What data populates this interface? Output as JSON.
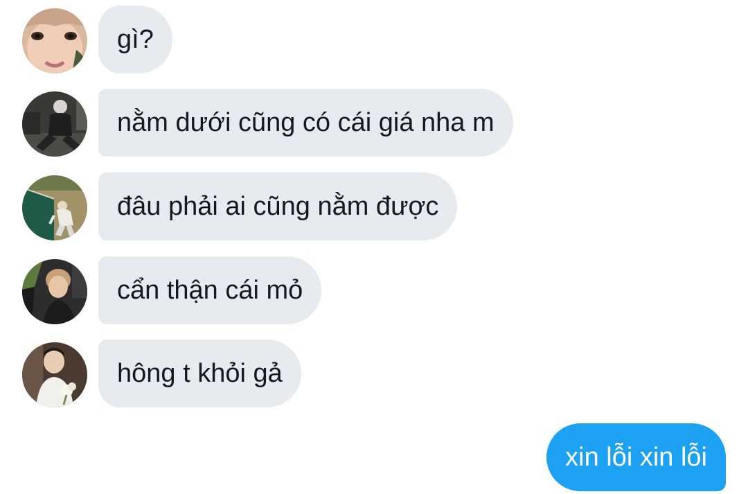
{
  "conversation": {
    "received": [
      {
        "text": "gì?",
        "avatar": "avatar-close-up-face"
      },
      {
        "text": "nằm dưới cũng có cái giá nha m",
        "avatar": "avatar-sitting-night"
      },
      {
        "text": "đâu phải ai cũng nằm được",
        "avatar": "avatar-outdoor-grass"
      },
      {
        "text": "cẩn thận cái mỏ",
        "avatar": "avatar-car-selfie"
      },
      {
        "text": "hông t khỏi gả",
        "avatar": "avatar-white-shirt-flowers"
      }
    ],
    "sent": [
      {
        "text": "xin lỗi xin lỗi"
      }
    ]
  },
  "colors": {
    "received_bubble": "#e6ebf0",
    "received_text": "#15191f",
    "sent_bubble": "#1da1f2",
    "sent_text": "#ffffff",
    "background": "#ffffff"
  }
}
